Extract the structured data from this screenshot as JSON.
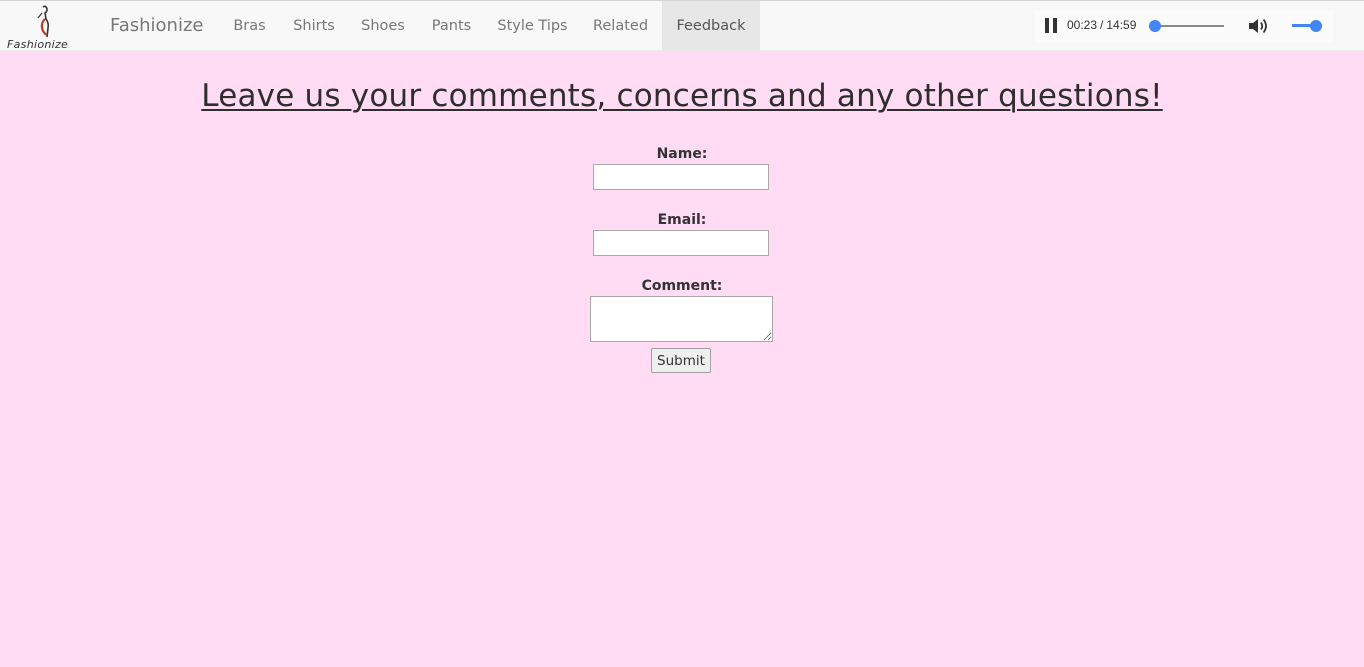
{
  "nav": {
    "logo_text": "Fashionize",
    "brand": "Fashionize",
    "items": [
      {
        "label": "Bras"
      },
      {
        "label": "Shirts"
      },
      {
        "label": "Shoes"
      },
      {
        "label": "Pants"
      },
      {
        "label": "Style Tips"
      },
      {
        "label": "Related"
      },
      {
        "label": "Feedback",
        "active": true
      }
    ]
  },
  "player": {
    "current_time": "00:23",
    "separator": "/",
    "duration": "14:59",
    "progress_fraction": 0.026,
    "volume_fraction": 0.8,
    "icons": [
      "pause-icon",
      "volume-icon"
    ],
    "accent_color": "#4285f4"
  },
  "page": {
    "heading": "Leave us your comments, concerns and any other questions!",
    "background_color": "#ffdcf3"
  },
  "form": {
    "name_label": "Name:",
    "name_value": "",
    "email_label": "Email:",
    "email_value": "",
    "comment_label": "Comment:",
    "comment_value": "",
    "submit_label": "Submit"
  }
}
